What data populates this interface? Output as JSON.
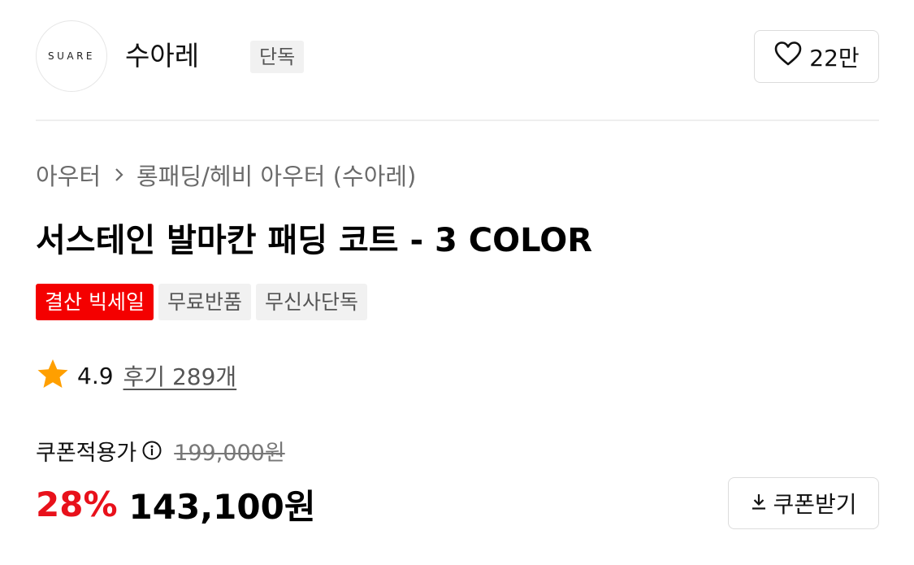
{
  "brand": {
    "logo_text": "SUARE",
    "name": "수아레",
    "tag": "단독",
    "likes": "22만"
  },
  "breadcrumb": {
    "category": "아우터",
    "subcategory": "롱패딩/헤비 아우터 (수아레)"
  },
  "product": {
    "title": "서스테인 발마칸 패딩 코트 - 3 COLOR",
    "badges": [
      "결산 빅세일",
      "무료반품",
      "무신사단독"
    ]
  },
  "rating": {
    "score": "4.9",
    "reviews": "후기 289개"
  },
  "price": {
    "coupon_label": "쿠폰적용가",
    "original": "199,000원",
    "discount": "28%",
    "final": "143,100원",
    "coupon_button": "쿠폰받기"
  },
  "colors": {
    "sale_badge": "#f40000",
    "discount": "#e8111b",
    "star": "#ff9f00"
  },
  "icons": {
    "like": "heart-icon",
    "breadcrumb_separator": "chevron-right-icon",
    "rating": "star-icon",
    "info": "info-icon",
    "download": "download-icon"
  }
}
